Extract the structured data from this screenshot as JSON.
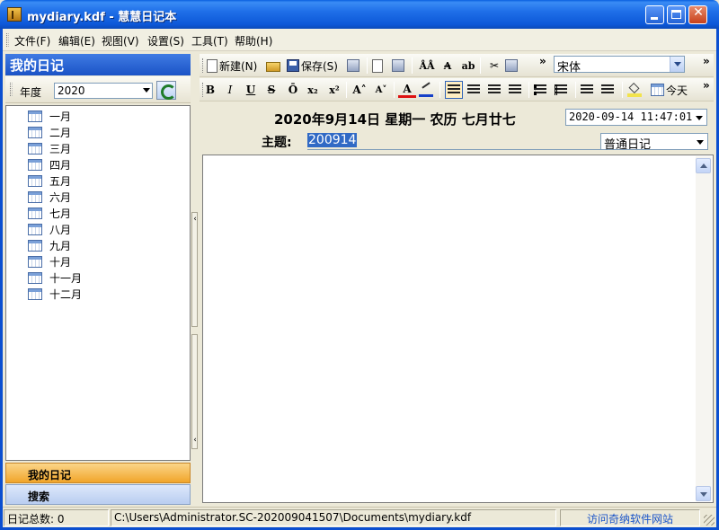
{
  "window": {
    "title": "mydiary.kdf - 慧慧日记本"
  },
  "menu": [
    "文件(F)",
    "编辑(E)",
    "视图(V)",
    "设置(S)",
    "工具(T)",
    "帮助(H)"
  ],
  "sidebar": {
    "header": "我的日记",
    "year_label": "年度",
    "year_value": "2020",
    "months": [
      "一月",
      "二月",
      "三月",
      "四月",
      "五月",
      "六月",
      "七月",
      "八月",
      "九月",
      "十月",
      "十一月",
      "十二月"
    ],
    "nav_tabs": [
      "我的日记",
      "搜索"
    ]
  },
  "toolbar1": {
    "new_label": "新建(N)",
    "save_label": "保存(S)",
    "font_value": "宋体"
  },
  "toolbar2": {
    "bold": "B",
    "italic": "I",
    "underline": "U",
    "strike": "S",
    "overline": "Ō",
    "subscript": "x₂",
    "superscript": "x²",
    "grow": "A˄",
    "shrink": "A˅",
    "today_label": "今天"
  },
  "entry": {
    "date_title": "2020年9月14日  星期一   农历  七月廿七",
    "datetime_value": "2020-09-14 11:47:01",
    "subject_label": "主题:",
    "subject_value": "200914",
    "type_value": "普通日记"
  },
  "statusbar": {
    "count_text": "日记总数: 0",
    "path": "C:\\Users\\Administrator.SC-202009041507\\Documents\\mydiary.kdf",
    "link": "访问奇纳软件网站"
  },
  "colors": {
    "title_blue": "#0d58d8",
    "accent_orange": "#f1a52a",
    "selection": "#316ac5",
    "link": "#1b55c8"
  }
}
